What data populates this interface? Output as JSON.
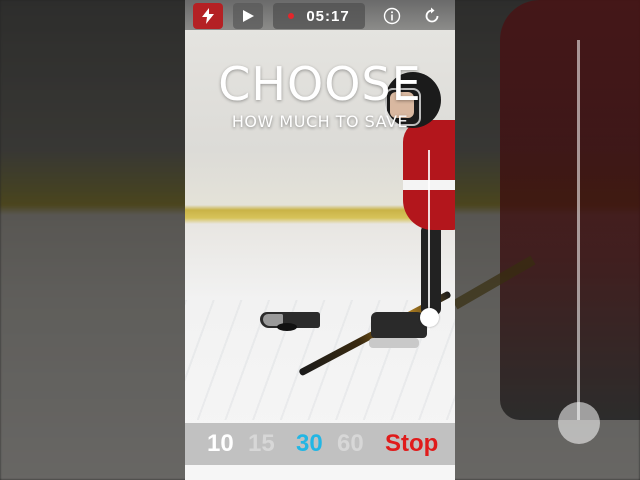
{
  "toolbar": {
    "timer": "05:17",
    "icons": {
      "flash": "lightning-icon",
      "play": "play-icon",
      "recording": "record-dot-icon",
      "info": "info-icon",
      "reset": "refresh-icon"
    },
    "flash_color": "#b42124"
  },
  "headline": {
    "title": "CHOOSE",
    "subtitle": "HOW MUCH TO SAVE"
  },
  "save_options": {
    "opt_10": "10",
    "opt_15": "15",
    "opt_30": "30",
    "opt_60": "60",
    "stop": "Stop",
    "selected": "30",
    "colors": {
      "selected": "#22b6e4",
      "stop": "#e01b1b",
      "default": "#d7d7d7"
    }
  },
  "slider": {
    "level": 0.1
  }
}
